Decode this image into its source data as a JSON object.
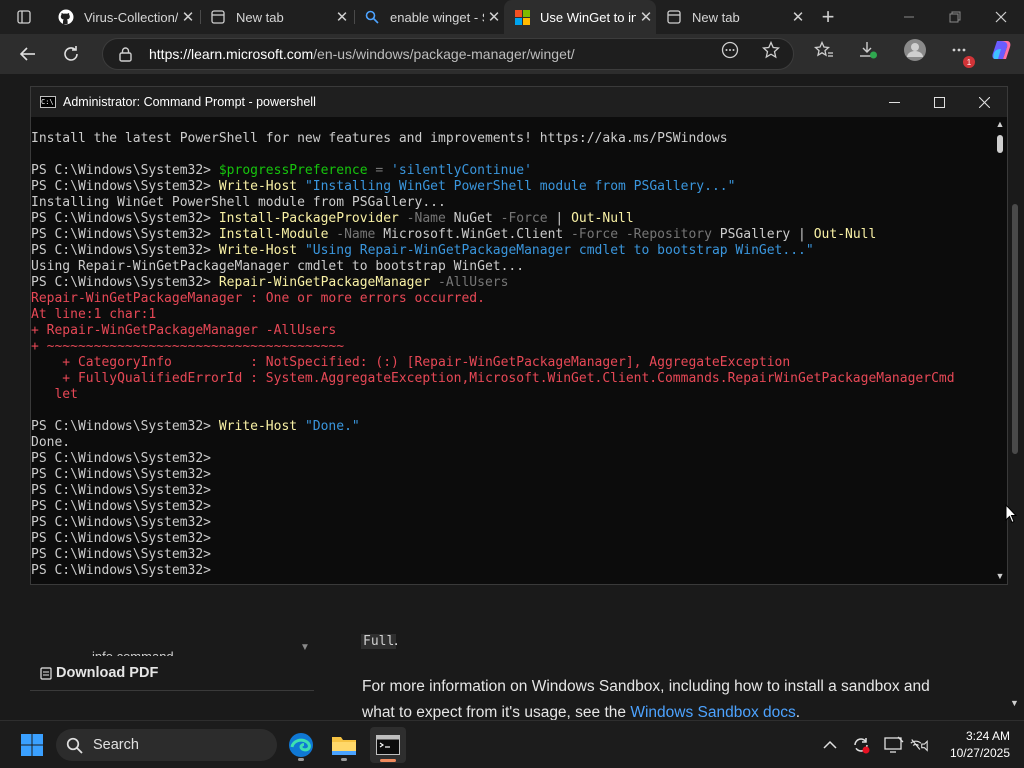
{
  "browser": {
    "tabs": [
      {
        "label": "Virus-Collection/",
        "icon": "github-icon"
      },
      {
        "label": "New tab",
        "icon": "new-tab-icon"
      },
      {
        "label": "enable winget - S",
        "icon": "search-icon"
      },
      {
        "label": "Use WinGet to in",
        "icon": "microsoft-icon",
        "active": true
      },
      {
        "label": "New tab",
        "icon": "new-tab-icon"
      }
    ],
    "new_tab_glyph": "+",
    "url_host": "https://learn.microsoft.com",
    "url_path": "/en-us/windows/package-manager/winget/",
    "notification_badge": "1"
  },
  "page": {
    "partial_link": "info command",
    "code_full": "Full",
    "code_after": ".",
    "download_pdf": "Download PDF",
    "paragraph_line1": "For more information on Windows Sandbox, including how to install a sandbox and",
    "paragraph_line2_prefix": "what to expect from it's usage, see the ",
    "paragraph_link": "Windows Sandbox docs",
    "paragraph_line2_suffix": "."
  },
  "console": {
    "title": "Administrator: Command Prompt - powershell",
    "lines": [
      [
        {
          "t": "Install the latest PowerShell for new features and improvements! https://aka.ms/PSWindows",
          "c": "w"
        }
      ],
      [],
      [
        {
          "t": "PS C:\\Windows\\System32> ",
          "c": "w"
        },
        {
          "t": "$progressPreference",
          "c": "g"
        },
        {
          "t": " = ",
          "c": "gr"
        },
        {
          "t": "'silentlyContinue'",
          "c": "q"
        }
      ],
      [
        {
          "t": "PS C:\\Windows\\System32> ",
          "c": "w"
        },
        {
          "t": "Write-Host",
          "c": "y"
        },
        {
          "t": " \"Installing WinGet PowerShell module from PSGallery...\"",
          "c": "q"
        }
      ],
      [
        {
          "t": "Installing WinGet PowerShell module from PSGallery...",
          "c": "w"
        }
      ],
      [
        {
          "t": "PS C:\\Windows\\System32> ",
          "c": "w"
        },
        {
          "t": "Install-PackageProvider",
          "c": "y"
        },
        {
          "t": " -Name",
          "c": "gr"
        },
        {
          "t": " NuGet",
          "c": "w"
        },
        {
          "t": " -Force",
          "c": "gr"
        },
        {
          "t": " | ",
          "c": "w"
        },
        {
          "t": "Out-Null",
          "c": "y"
        }
      ],
      [
        {
          "t": "PS C:\\Windows\\System32> ",
          "c": "w"
        },
        {
          "t": "Install-Module",
          "c": "y"
        },
        {
          "t": " -Name",
          "c": "gr"
        },
        {
          "t": " Microsoft.WinGet.Client",
          "c": "w"
        },
        {
          "t": " -Force",
          "c": "gr"
        },
        {
          "t": " -Repository",
          "c": "gr"
        },
        {
          "t": " PSGallery",
          "c": "w"
        },
        {
          "t": " | ",
          "c": "w"
        },
        {
          "t": "Out-Null",
          "c": "y"
        }
      ],
      [
        {
          "t": "PS C:\\Windows\\System32> ",
          "c": "w"
        },
        {
          "t": "Write-Host",
          "c": "y"
        },
        {
          "t": " \"Using Repair-WinGetPackageManager cmdlet to bootstrap WinGet...\"",
          "c": "q"
        }
      ],
      [
        {
          "t": "Using Repair-WinGetPackageManager cmdlet to bootstrap WinGet...",
          "c": "w"
        }
      ],
      [
        {
          "t": "PS C:\\Windows\\System32> ",
          "c": "w"
        },
        {
          "t": "Repair-WinGetPackageManager",
          "c": "y"
        },
        {
          "t": " -AllUsers",
          "c": "gr"
        }
      ],
      [
        {
          "t": "Repair-WinGetPackageManager : One or more errors occurred.",
          "c": "r"
        }
      ],
      [
        {
          "t": "At line:1 char:1",
          "c": "r"
        }
      ],
      [
        {
          "t": "+ Repair-WinGetPackageManager -AllUsers",
          "c": "r"
        }
      ],
      [
        {
          "t": "+ ~~~~~~~~~~~~~~~~~~~~~~~~~~~~~~~~~~~~~~",
          "c": "r"
        }
      ],
      [
        {
          "t": "    + CategoryInfo          : NotSpecified: (:) [Repair-WinGetPackageManager], AggregateException",
          "c": "r"
        }
      ],
      [
        {
          "t": "    + FullyQualifiedErrorId : System.AggregateException,Microsoft.WinGet.Client.Commands.RepairWinGetPackageManagerCmd",
          "c": "r"
        }
      ],
      [
        {
          "t": "   let",
          "c": "r"
        }
      ],
      [],
      [
        {
          "t": "PS C:\\Windows\\System32> ",
          "c": "w"
        },
        {
          "t": "Write-Host",
          "c": "y"
        },
        {
          "t": " \"Done.\"",
          "c": "q"
        }
      ],
      [
        {
          "t": "Done.",
          "c": "w"
        }
      ],
      [
        {
          "t": "PS C:\\Windows\\System32>",
          "c": "w"
        }
      ],
      [
        {
          "t": "PS C:\\Windows\\System32>",
          "c": "w"
        }
      ],
      [
        {
          "t": "PS C:\\Windows\\System32>",
          "c": "w"
        }
      ],
      [
        {
          "t": "PS C:\\Windows\\System32>",
          "c": "w"
        }
      ],
      [
        {
          "t": "PS C:\\Windows\\System32>",
          "c": "w"
        }
      ],
      [
        {
          "t": "PS C:\\Windows\\System32>",
          "c": "w"
        }
      ],
      [
        {
          "t": "PS C:\\Windows\\System32>",
          "c": "w"
        }
      ],
      [
        {
          "t": "PS C:\\Windows\\System32>",
          "c": "w"
        }
      ]
    ]
  },
  "taskbar": {
    "search_label": "Search",
    "time": "3:24 AM",
    "date": "10/27/2025"
  },
  "colors": {
    "accent_blue": "#4da3ff",
    "error_red": "#e74856",
    "command_yellow": "#f9f1a5"
  }
}
